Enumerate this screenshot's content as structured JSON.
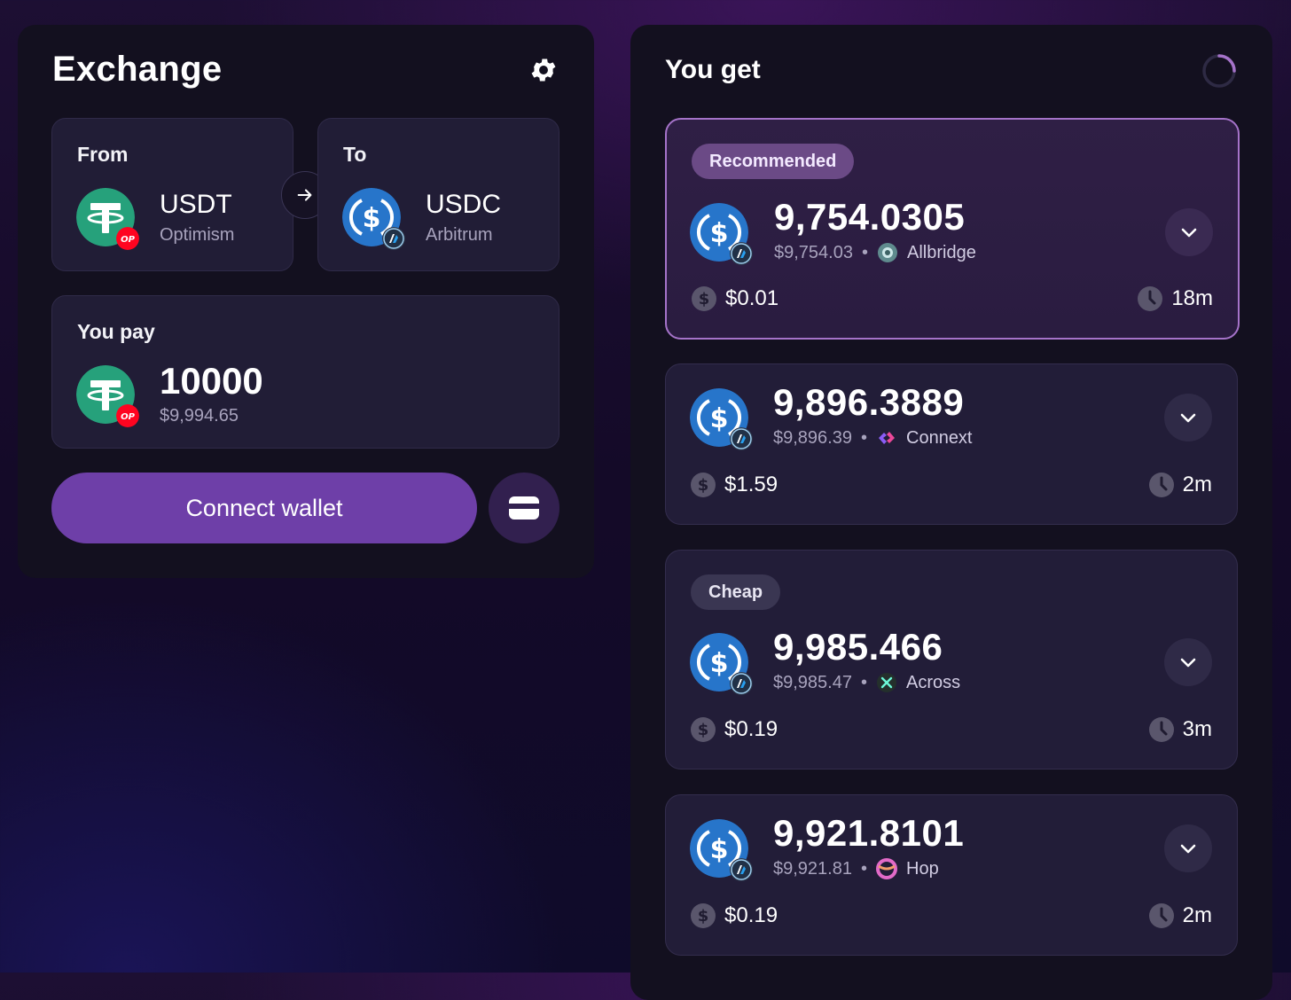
{
  "exchange": {
    "title": "Exchange",
    "settings_icon": "gear-icon",
    "from": {
      "label": "From",
      "token": "USDT",
      "chain": "Optimism",
      "chain_badge": "OP"
    },
    "to": {
      "label": "To",
      "token": "USDC",
      "chain": "Arbitrum"
    },
    "pay": {
      "label": "You pay",
      "amount": "10000",
      "usd": "$9,994.65"
    },
    "connect_label": "Connect wallet",
    "colors": {
      "accent": "#6e3fa8",
      "usdt": "#26a17b",
      "usdc": "#2775ca",
      "op": "#ff0420"
    }
  },
  "you_get": {
    "title": "You get",
    "routes": [
      {
        "tag": "Recommended",
        "amount": "9,754.0305",
        "usd": "$9,754.03",
        "bridge": "Allbridge",
        "fee": "$0.01",
        "time": "18m"
      },
      {
        "tag": "",
        "amount": "9,896.3889",
        "usd": "$9,896.39",
        "bridge": "Connext",
        "fee": "$1.59",
        "time": "2m"
      },
      {
        "tag": "Cheap",
        "amount": "9,985.466",
        "usd": "$9,985.47",
        "bridge": "Across",
        "fee": "$0.19",
        "time": "3m"
      },
      {
        "tag": "",
        "amount": "9,921.8101",
        "usd": "$9,921.81",
        "bridge": "Hop",
        "fee": "$0.19",
        "time": "2m"
      }
    ]
  }
}
